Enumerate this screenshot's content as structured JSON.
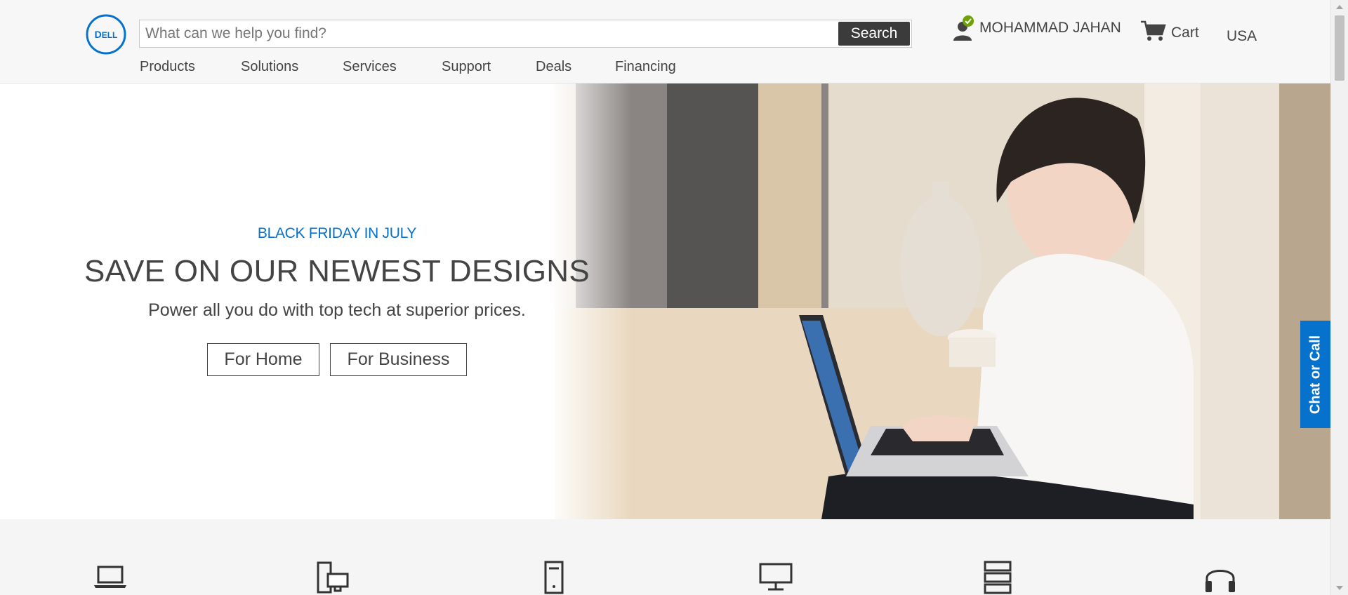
{
  "header": {
    "search": {
      "placeholder": "What can we help you find?",
      "button_label": "Search"
    },
    "account": {
      "name": "MOHAMMAD JAHAN",
      "status": "signed-in"
    },
    "cart_label": "Cart",
    "country": "USA"
  },
  "nav": {
    "items": [
      {
        "label": "Products"
      },
      {
        "label": "Solutions"
      },
      {
        "label": "Services"
      },
      {
        "label": "Support"
      },
      {
        "label": "Deals"
      },
      {
        "label": "Financing"
      }
    ]
  },
  "hero": {
    "eyebrow": "BLACK FRIDAY IN JULY",
    "headline": "SAVE ON OUR NEWEST DESIGNS",
    "subline": "Power all you do with top tech at superior prices.",
    "cta_home": "For Home",
    "cta_business": "For Business",
    "image": "woman-with-laptop-photo"
  },
  "chat_tab": {
    "label": "Chat or Call"
  },
  "categories": {
    "icons": [
      "laptop-icon",
      "desktop-tower-icon",
      "server-tower-icon",
      "monitor-icon",
      "storage-rack-icon",
      "headset-icon"
    ]
  },
  "colors": {
    "accent": "#0672cb",
    "dark_button": "#3b3b3b",
    "badge_green": "#6ea204",
    "text": "#444444"
  }
}
